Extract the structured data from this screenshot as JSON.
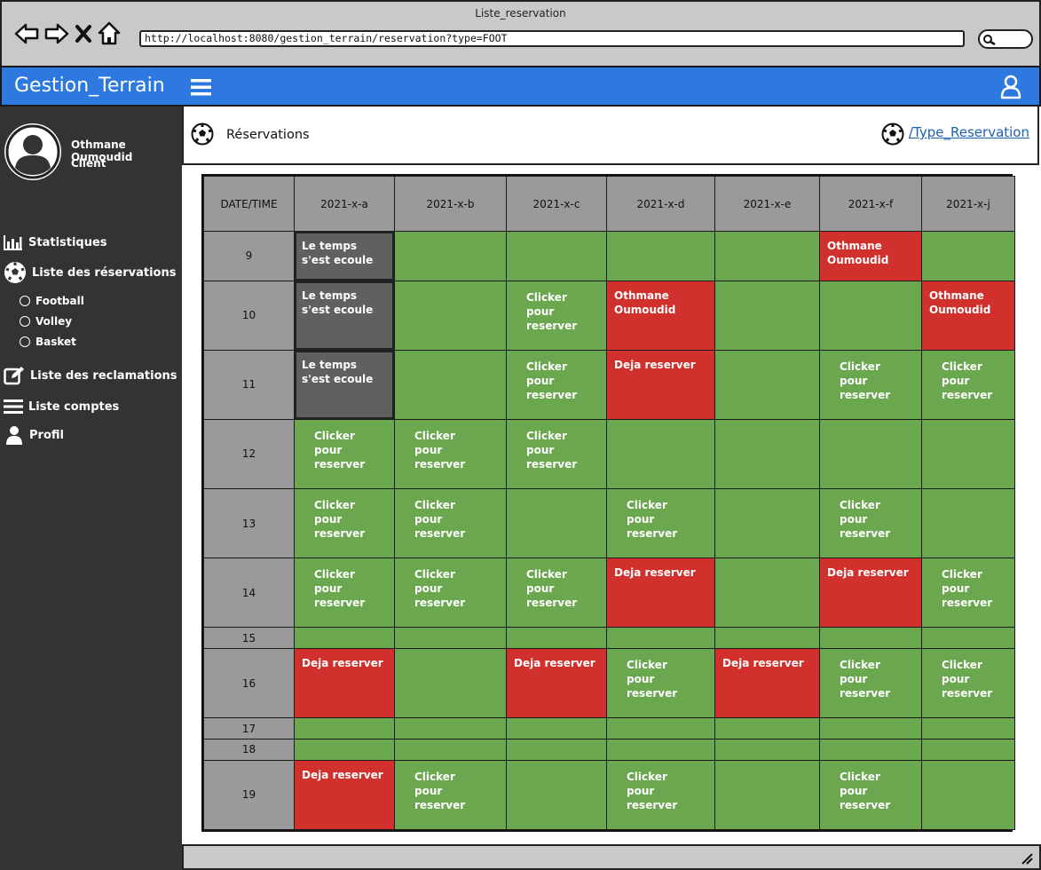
{
  "window": {
    "title": "Liste_reservation"
  },
  "browser": {
    "url": "http://localhost:8080/gestion_terrain/reservation?type=FOOT"
  },
  "app": {
    "title": "Gestion_Terrain"
  },
  "user": {
    "name": "Othmane Oumoudid",
    "role": "Client"
  },
  "sidebar": {
    "statistiques": "Statistiques",
    "reservations": "Liste des réservations",
    "sub": [
      "Football",
      "Volley",
      "Basket"
    ],
    "reclamations": "Liste des reclamations",
    "comptes": "Liste comptes",
    "profil": "Profil"
  },
  "content": {
    "title": "Réservations",
    "type_link": "/Type_Reservation"
  },
  "table": {
    "corner": "DATE/TIME",
    "columns": [
      "2021-x-a",
      "2021-x-b",
      "2021-x-c",
      "2021-x-d",
      "2021-x-e",
      "2021-x-f",
      "2021-x-j"
    ],
    "rows": [
      {
        "time": "9",
        "cells": [
          {
            "s": "gray",
            "t": "Le temps s'est ecoule"
          },
          {
            "s": "green",
            "t": ""
          },
          {
            "s": "green",
            "t": ""
          },
          {
            "s": "green",
            "t": ""
          },
          {
            "s": "green",
            "t": ""
          },
          {
            "s": "red",
            "t": "Othmane Oumoudid"
          },
          {
            "s": "green",
            "t": ""
          }
        ]
      },
      {
        "time": "10",
        "cells": [
          {
            "s": "gray",
            "t": "Le temps s'est ecoule"
          },
          {
            "s": "green",
            "t": ""
          },
          {
            "s": "green",
            "t": "Clicker pour reserver"
          },
          {
            "s": "red",
            "t": "Othmane Oumoudid"
          },
          {
            "s": "green",
            "t": ""
          },
          {
            "s": "green",
            "t": ""
          },
          {
            "s": "red",
            "t": "Othmane Oumoudid"
          }
        ]
      },
      {
        "time": "11",
        "cells": [
          {
            "s": "gray",
            "t": "Le temps s'est ecoule"
          },
          {
            "s": "green",
            "t": ""
          },
          {
            "s": "green",
            "t": "Clicker pour reserver"
          },
          {
            "s": "red",
            "t": "Deja reserver"
          },
          {
            "s": "green",
            "t": ""
          },
          {
            "s": "green",
            "t": "Clicker pour reserver"
          },
          {
            "s": "green",
            "t": "Clicker pour reserver"
          }
        ]
      },
      {
        "time": "12",
        "cells": [
          {
            "s": "green",
            "t": "Clicker pour reserver"
          },
          {
            "s": "green",
            "t": "Clicker pour reserver"
          },
          {
            "s": "green",
            "t": "Clicker pour reserver"
          },
          {
            "s": "green",
            "t": ""
          },
          {
            "s": "green",
            "t": ""
          },
          {
            "s": "green",
            "t": ""
          },
          {
            "s": "green",
            "t": ""
          }
        ]
      },
      {
        "time": "13",
        "cells": [
          {
            "s": "green",
            "t": "Clicker pour reserver"
          },
          {
            "s": "green",
            "t": "Clicker pour reserver"
          },
          {
            "s": "green",
            "t": ""
          },
          {
            "s": "green",
            "t": "Clicker pour reserver"
          },
          {
            "s": "green",
            "t": ""
          },
          {
            "s": "green",
            "t": "Clicker pour reserver"
          },
          {
            "s": "green",
            "t": ""
          }
        ]
      },
      {
        "time": "14",
        "cells": [
          {
            "s": "green",
            "t": "Clicker pour reserver"
          },
          {
            "s": "green",
            "t": "Clicker pour reserver"
          },
          {
            "s": "green",
            "t": "Clicker pour reserver"
          },
          {
            "s": "red",
            "t": "Deja reserver"
          },
          {
            "s": "green",
            "t": ""
          },
          {
            "s": "red",
            "t": "Deja reserver"
          },
          {
            "s": "green",
            "t": "Clicker pour reserver"
          }
        ]
      },
      {
        "time": "15",
        "cells": [
          {
            "s": "green",
            "t": ""
          },
          {
            "s": "green",
            "t": ""
          },
          {
            "s": "green",
            "t": ""
          },
          {
            "s": "green",
            "t": ""
          },
          {
            "s": "green",
            "t": ""
          },
          {
            "s": "green",
            "t": ""
          },
          {
            "s": "green",
            "t": ""
          }
        ]
      },
      {
        "time": "16",
        "cells": [
          {
            "s": "red",
            "t": "Deja reserver"
          },
          {
            "s": "green",
            "t": ""
          },
          {
            "s": "red",
            "t": "Deja reserver"
          },
          {
            "s": "green",
            "t": "Clicker pour reserver"
          },
          {
            "s": "red",
            "t": "Deja reserver"
          },
          {
            "s": "green",
            "t": "Clicker pour reserver"
          },
          {
            "s": "green",
            "t": "Clicker pour reserver"
          }
        ]
      },
      {
        "time": "17",
        "cells": [
          {
            "s": "green",
            "t": ""
          },
          {
            "s": "green",
            "t": ""
          },
          {
            "s": "green",
            "t": ""
          },
          {
            "s": "green",
            "t": ""
          },
          {
            "s": "green",
            "t": ""
          },
          {
            "s": "green",
            "t": ""
          },
          {
            "s": "green",
            "t": ""
          }
        ]
      },
      {
        "time": "18",
        "cells": [
          {
            "s": "green",
            "t": ""
          },
          {
            "s": "green",
            "t": ""
          },
          {
            "s": "green",
            "t": ""
          },
          {
            "s": "green",
            "t": ""
          },
          {
            "s": "green",
            "t": ""
          },
          {
            "s": "green",
            "t": ""
          },
          {
            "s": "green",
            "t": ""
          }
        ]
      },
      {
        "time": "19",
        "cells": [
          {
            "s": "red",
            "t": "Deja reserver"
          },
          {
            "s": "green",
            "t": "Clicker pour reserver"
          },
          {
            "s": "green",
            "t": ""
          },
          {
            "s": "green",
            "t": "Clicker pour reserver"
          },
          {
            "s": "green",
            "t": ""
          },
          {
            "s": "green",
            "t": "Clicker pour reserver"
          },
          {
            "s": "green",
            "t": ""
          }
        ]
      }
    ]
  },
  "colors": {
    "header_blue": "#2d79df",
    "sidebar": "#333333",
    "free_green": "#6aa74f",
    "reserved_red": "#d2302c",
    "expired_gray": "#606060"
  },
  "icons": [
    "back-arrow-icon",
    "forward-arrow-icon",
    "close-icon",
    "home-icon",
    "search-icon",
    "hamburger-menu-icon",
    "user-icon",
    "soccer-ball-icon",
    "bar-chart-icon",
    "edit-icon",
    "list-icon",
    "person-icon",
    "chevron-down-icon"
  ]
}
